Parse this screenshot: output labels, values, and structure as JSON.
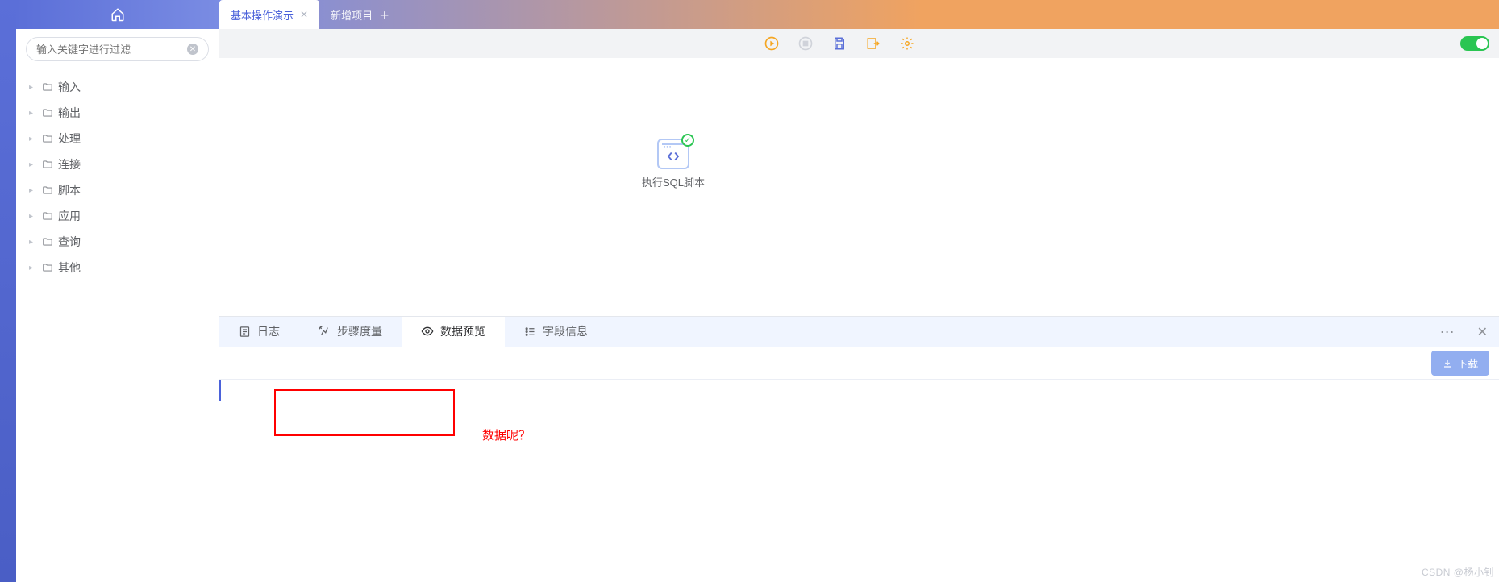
{
  "header": {
    "tabs": [
      {
        "label": "基本操作演示",
        "active": true,
        "closable": true
      },
      {
        "label": "新增项目",
        "add": true
      }
    ]
  },
  "sidebar": {
    "search_placeholder": "输入关键字进行过滤",
    "tree": [
      {
        "label": "输入"
      },
      {
        "label": "输出"
      },
      {
        "label": "处理"
      },
      {
        "label": "连接"
      },
      {
        "label": "脚本"
      },
      {
        "label": "应用"
      },
      {
        "label": "查询"
      },
      {
        "label": "其他"
      }
    ]
  },
  "canvas": {
    "node_label": "执行SQL脚本"
  },
  "bottom": {
    "tabs": [
      {
        "label": "日志",
        "icon": "log"
      },
      {
        "label": "步骤度量",
        "icon": "metrics"
      },
      {
        "label": "数据预览",
        "icon": "preview",
        "active": true
      },
      {
        "label": "字段信息",
        "icon": "fields"
      }
    ],
    "download_label": "下载",
    "annotation_text": "数据呢？"
  },
  "watermark": "CSDN @杨小钊"
}
